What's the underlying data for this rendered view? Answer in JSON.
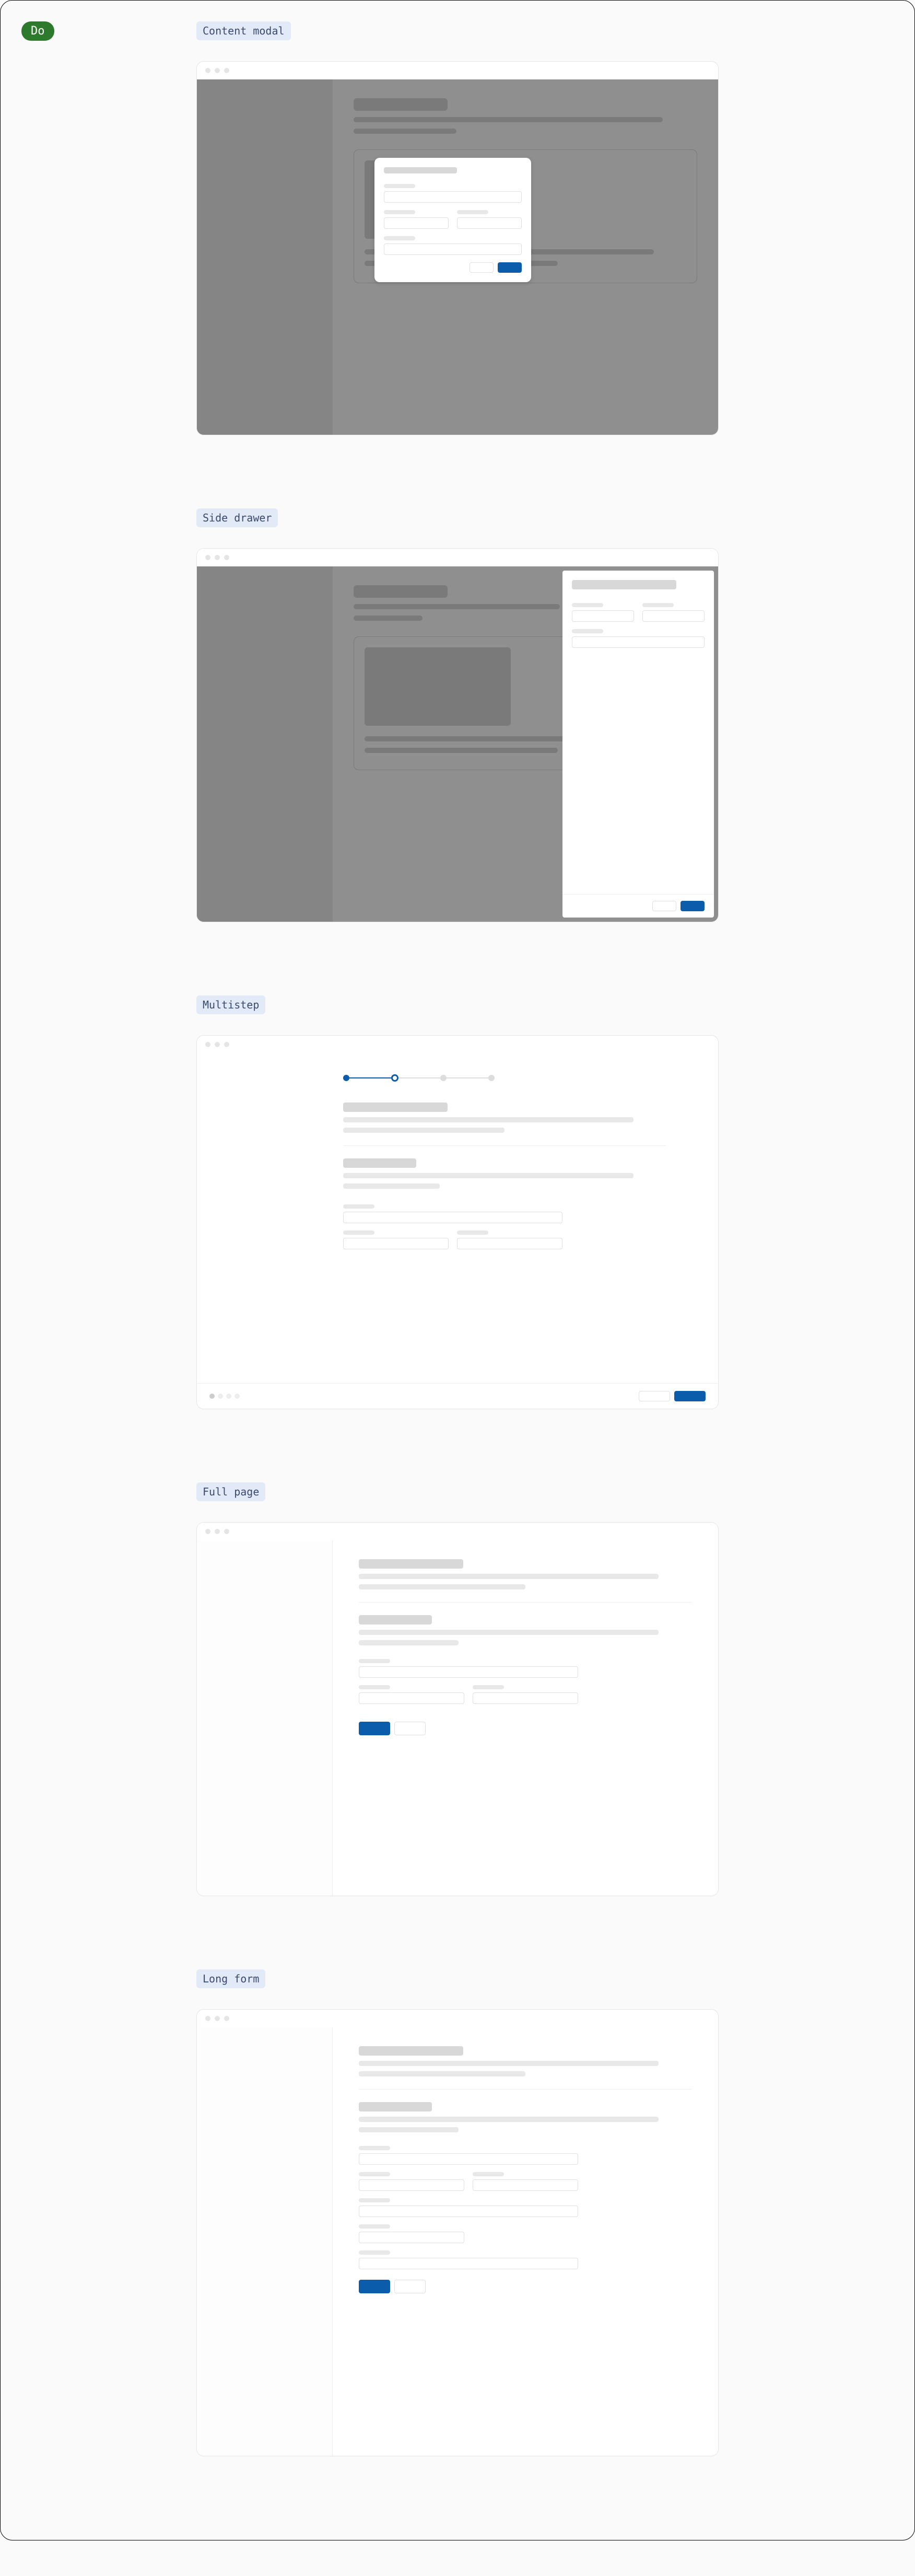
{
  "badge": "Do",
  "sections": {
    "content_modal": "Content modal",
    "side_drawer": "Side drawer",
    "multistep": "Multistep",
    "full_page": "Full page",
    "long_form": "Long form"
  }
}
